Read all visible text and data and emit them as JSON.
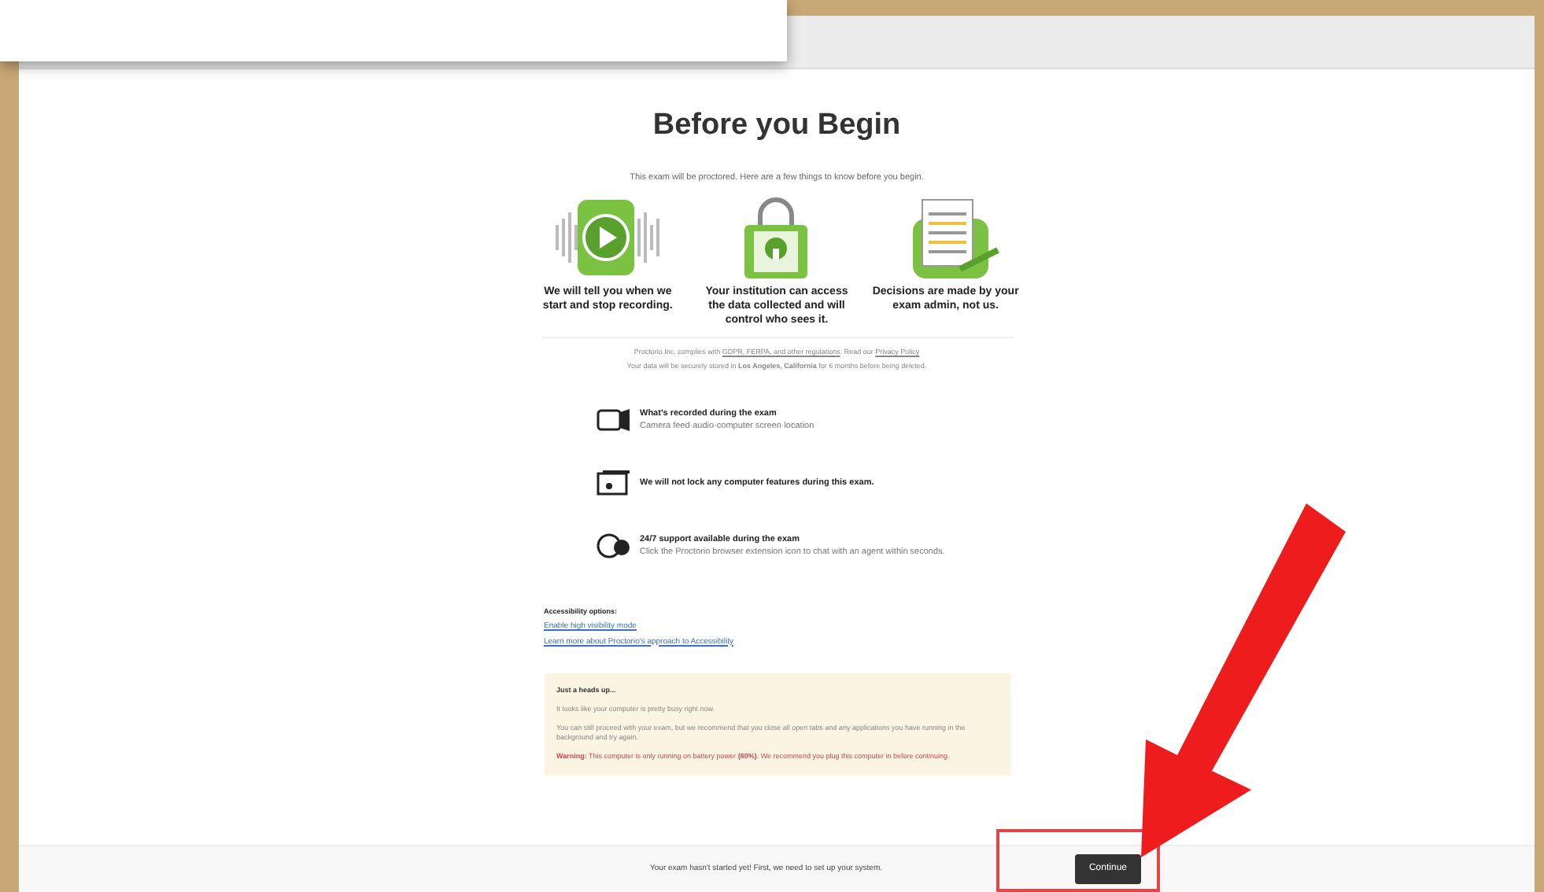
{
  "page": {
    "title": "Before you Begin",
    "intro": "This exam will be proctored. Here are a few things to know before you begin."
  },
  "features": [
    {
      "kind": "recording",
      "caption": "We will tell you when we start and stop recording."
    },
    {
      "kind": "lock",
      "caption": "Your institution can access the data collected and will control who sees it."
    },
    {
      "kind": "document",
      "caption": "Decisions are made by your exam admin, not us."
    }
  ],
  "policy": {
    "prefix": "Proctorio Inc. complies with ",
    "link": "GDPR, FERPA, and other regulations",
    "middle": ". Read our ",
    "privacy_link": "Privacy Policy",
    "storage": "Your data will be securely stored in **Los Angeles, California** for 6 months before being deleted."
  },
  "info_items": [
    {
      "kind": "camera",
      "title": "What's recorded during the exam",
      "detail": "Camera feed·audio·computer screen·location"
    },
    {
      "kind": "screen",
      "title": "We will not lock any computer features during this exam."
    },
    {
      "kind": "chat",
      "title": "24/7 support available during the exam",
      "detail": "Click the Proctorio browser extension icon to chat with an agent within seconds."
    }
  ],
  "accessibility": {
    "heading": "Accessibility options:",
    "links": [
      "Enable high visibility mode",
      "Learn more about Proctorio's approach to Accessibility"
    ]
  },
  "notice": {
    "heading": "Just a heads up...",
    "paragraphs": [
      "It looks like your computer is pretty busy right now.",
      "You can still proceed with your exam, but we recommend that you close all open tabs and any applications you have running in the background and try again."
    ],
    "warning": "**Warning:** This computer is only running on battery power **(80%)**. We recommend you plug this computer in before continuing."
  },
  "footer": {
    "message": "Your exam hasn't started yet! First, we need to set up your system.",
    "button": "Continue"
  }
}
